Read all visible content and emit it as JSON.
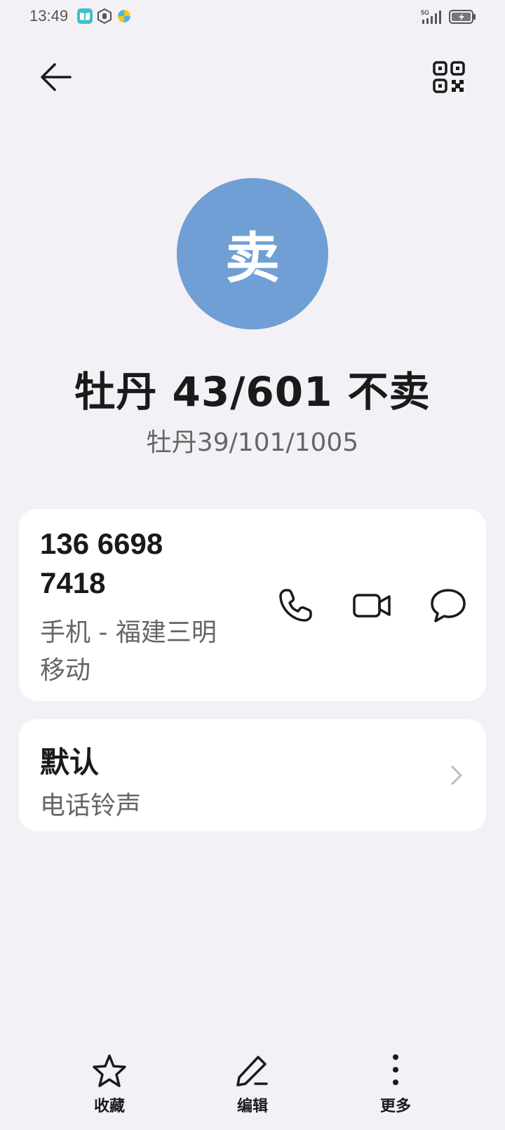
{
  "status_bar": {
    "time": "13:49",
    "network": "5G",
    "icons": [
      "book-app-icon",
      "hand-stop-icon",
      "pinwheel-icon",
      "signal-icon",
      "battery-charging-icon"
    ]
  },
  "header": {
    "back_icon": "arrow-left-icon",
    "qr_icon": "qr-code-icon"
  },
  "contact": {
    "avatar_letter": "卖",
    "avatar_color": "#6f9fd4",
    "name": "牡丹 43/601 不卖",
    "subtitle": "牡丹39/101/1005"
  },
  "phone_card": {
    "number_line1": "136 6698",
    "number_line2": "7418",
    "type_line1": "手机 - 福建三明",
    "type_line2": "移动",
    "actions": [
      "phone-icon",
      "video-call-icon",
      "message-icon"
    ]
  },
  "ringtone_card": {
    "title": "默认",
    "label": "电话铃声"
  },
  "bottom_nav": {
    "favorite_label": "收藏",
    "edit_label": "编辑",
    "more_label": "更多"
  }
}
